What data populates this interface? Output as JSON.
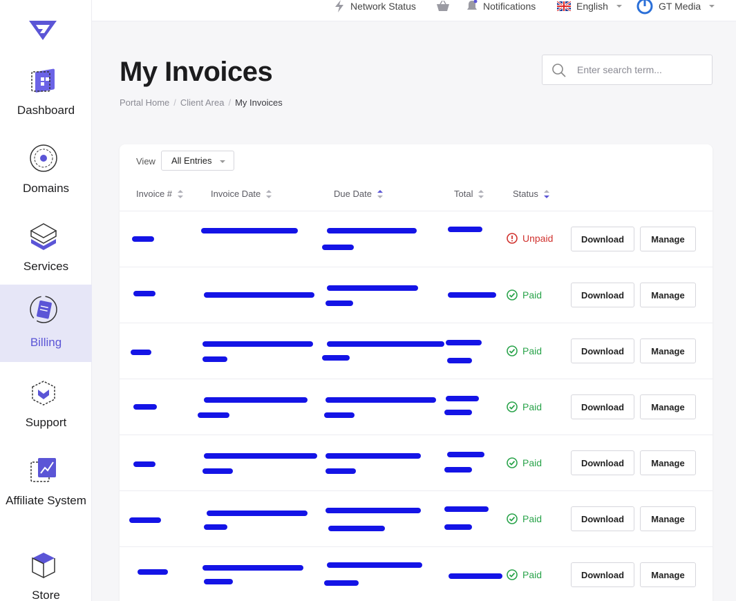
{
  "sidebar": {
    "items": [
      {
        "label": "Dashboard",
        "icon": "dashboard-icon"
      },
      {
        "label": "Domains",
        "icon": "globe-icon"
      },
      {
        "label": "Services",
        "icon": "layers-icon"
      },
      {
        "label": "Billing",
        "icon": "billing-icon",
        "active": true
      },
      {
        "label": "Support",
        "icon": "support-box-icon"
      },
      {
        "label": "Affiliate System",
        "icon": "affiliate-chart-icon"
      },
      {
        "label": "Store",
        "icon": "cube-icon"
      }
    ]
  },
  "topbar": {
    "network_status": "Network Status",
    "notifications": "Notifications",
    "language": "English",
    "account": "GT Media"
  },
  "page": {
    "title": "My Invoices",
    "search_placeholder": "Enter search term...",
    "breadcrumb": [
      "Portal Home",
      "Client Area",
      "My Invoices"
    ]
  },
  "table": {
    "view_label": "View",
    "view_value": "All Entries",
    "headers": {
      "invoice": "Invoice #",
      "invoice_date": "Invoice Date",
      "due_date": "Due Date",
      "total": "Total",
      "status": "Status"
    },
    "download_label": "Download",
    "manage_label": "Manage",
    "rows": [
      {
        "status": "Unpaid",
        "status_type": "unpaid"
      },
      {
        "status": "Paid",
        "status_type": "paid"
      },
      {
        "status": "Paid",
        "status_type": "paid"
      },
      {
        "status": "Paid",
        "status_type": "paid"
      },
      {
        "status": "Paid",
        "status_type": "paid"
      },
      {
        "status": "Paid",
        "status_type": "paid"
      },
      {
        "status": "Paid",
        "status_type": "paid"
      }
    ]
  },
  "colors": {
    "accent": "#5b55d6",
    "paid": "#29a34a",
    "unpaid": "#d0312d",
    "redaction": "#1414e6"
  }
}
